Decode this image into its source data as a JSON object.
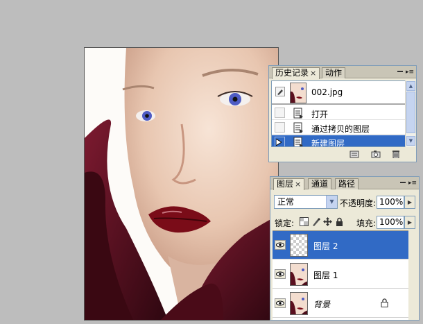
{
  "history_panel": {
    "tabs": [
      {
        "label": "历史记录",
        "close": "×"
      },
      {
        "label": "动作"
      }
    ],
    "snapshot": {
      "label": "002.jpg"
    },
    "steps": [
      {
        "label": "打开"
      },
      {
        "label": "通过拷贝的图层"
      },
      {
        "label": "新建图层"
      }
    ],
    "footer_icons": [
      "new-document-from-state-icon",
      "new-snapshot-icon",
      "trash-icon"
    ]
  },
  "layers_panel": {
    "tabs": [
      {
        "label": "图层",
        "close": "×"
      },
      {
        "label": "通道"
      },
      {
        "label": "路径"
      }
    ],
    "blend_mode": "正常",
    "opacity_label": "不透明度:",
    "opacity_value": "100%",
    "lock_label": "锁定:",
    "fill_label": "填充:",
    "fill_value": "100%",
    "layers": [
      {
        "name": "图层 2"
      },
      {
        "name": "图层 1"
      },
      {
        "name": "背景"
      }
    ]
  },
  "colors": {
    "selection": "#316ac5",
    "panel_bg": "#ece9d8",
    "workspace_bg": "#bdbdbd",
    "petal": "#5a0f1e",
    "lips": "#7a0c18"
  }
}
